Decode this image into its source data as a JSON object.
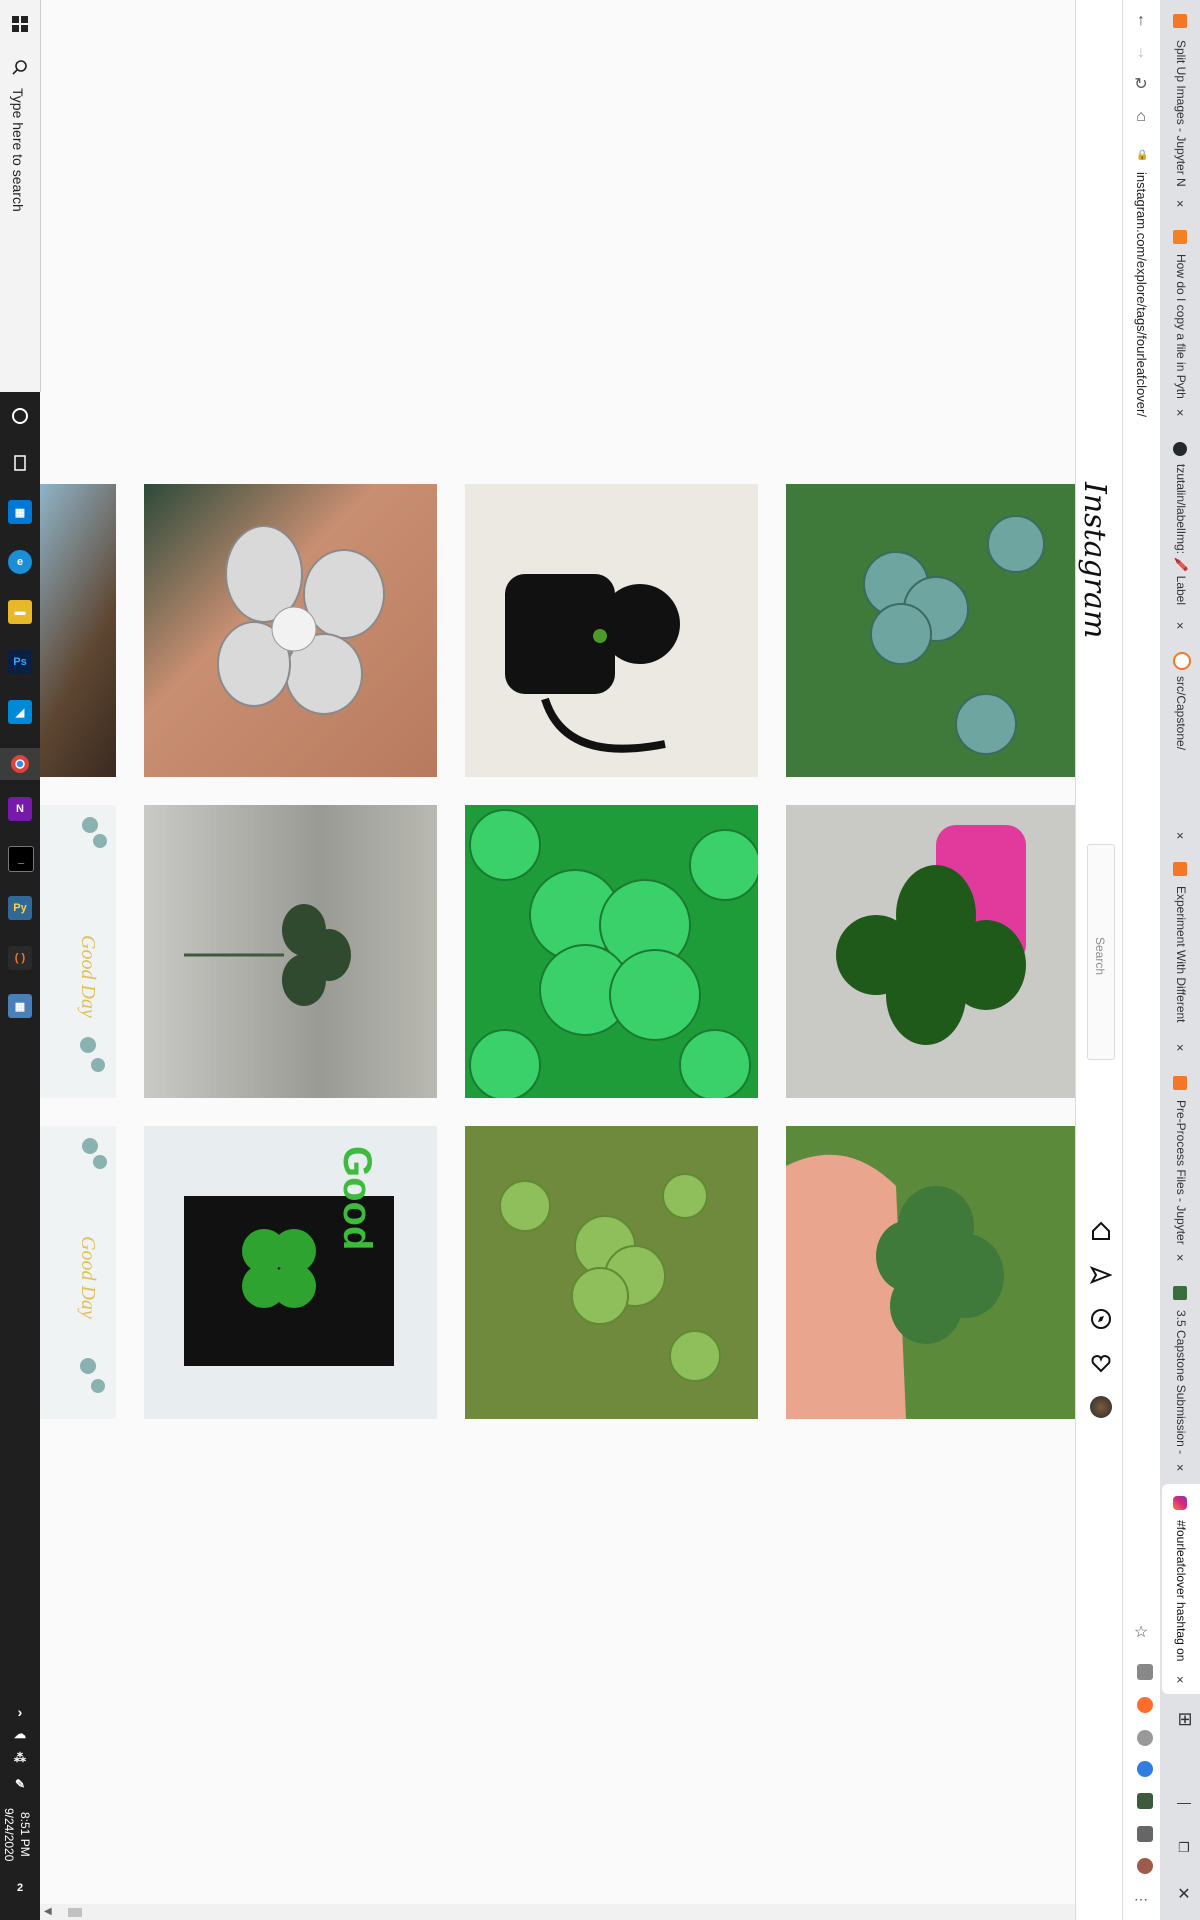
{
  "taskbar": {
    "search_placeholder": "Type here to search",
    "time": "8:51 PM",
    "date": "9/24/2020",
    "notification_count": "2"
  },
  "browser": {
    "address": "instagram.com/explore/tags/fourleafclover/",
    "tabs": [
      {
        "label": "Split Up Images - Jupyter N"
      },
      {
        "label": "How do I copy a file in Pyth"
      },
      {
        "label": "tzutalin/labelImg: 🖍️ Label"
      },
      {
        "label": "src/Capstone/"
      },
      {
        "label": "Experiment With Different"
      },
      {
        "label": "Pre-Process Files - Jupyter"
      },
      {
        "label": "3.5 Capstone Submission -"
      },
      {
        "label": "#fourleafclover hashtag on"
      }
    ]
  },
  "instagram": {
    "logo": "Instagram",
    "search_placeholder": "Search"
  },
  "colors": {
    "taskbar_bg": "#1f1f1f",
    "page_bg": "#fafafa",
    "clover_green": "#2f8f2f"
  }
}
